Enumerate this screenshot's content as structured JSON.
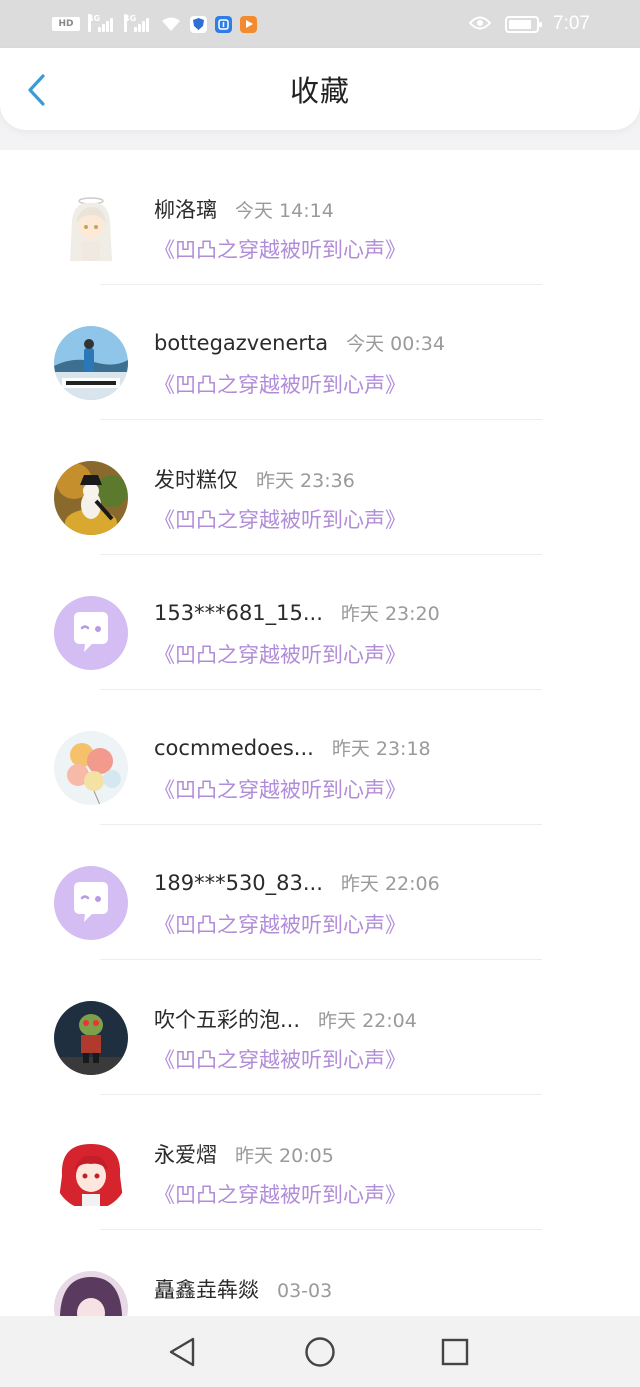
{
  "status_bar": {
    "hd": "HD",
    "net1": "4G",
    "net2": "4G",
    "time": "7:07"
  },
  "header": {
    "title": "收藏"
  },
  "items": [
    {
      "name": "柳洛璃",
      "time": "今天 14:14",
      "book": "《凹凸之穿越被听到心声》",
      "avatar": "avatar-anime-white-hair"
    },
    {
      "name": "bottegazvenerta",
      "time": "今天 00:34",
      "book": "《凹凸之穿越被听到心声》",
      "avatar": "avatar-person-sky"
    },
    {
      "name": "发时糕仅",
      "time": "昨天 23:36",
      "book": "《凹凸之穿越被听到心声》",
      "avatar": "avatar-cat-hat"
    },
    {
      "name": "153***681_15...",
      "time": "昨天 23:20",
      "book": "《凹凸之穿越被听到心声》",
      "avatar": "avatar-default-purple"
    },
    {
      "name": "cocmmedoes...",
      "time": "昨天 23:18",
      "book": "《凹凸之穿越被听到心声》",
      "avatar": "avatar-balloons"
    },
    {
      "name": "189***530_83...",
      "time": "昨天 22:06",
      "book": "《凹凸之穿越被听到心声》",
      "avatar": "avatar-default-purple"
    },
    {
      "name": "吹个五彩的泡...",
      "time": "昨天 22:04",
      "book": "《凹凸之穿越被听到心声》",
      "avatar": "avatar-zombie"
    },
    {
      "name": "永爱熠",
      "time": "昨天 20:05",
      "book": "《凹凸之穿越被听到心声》",
      "avatar": "avatar-anime-red-hair"
    },
    {
      "name": "矗鑫垚犇燚",
      "time": "03-03",
      "book": "",
      "avatar": "avatar-anime-dark"
    }
  ],
  "colors": {
    "accent": "#3a9bd9",
    "book_title": "#b18cd8",
    "default_avatar": "#d3bdf3"
  }
}
